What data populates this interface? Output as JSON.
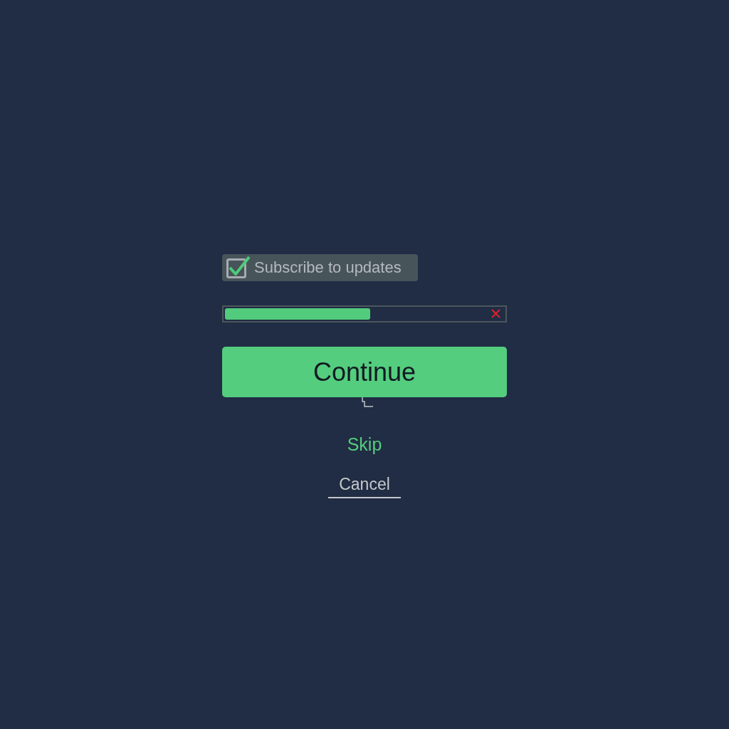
{
  "checkbox": {
    "label": "Subscribe to updates",
    "checked": true
  },
  "progress": {
    "level": 0.52
  },
  "buttons": [
    {
      "kind": "primary",
      "label": "Continue"
    },
    {
      "kind": "link",
      "label": "Skip"
    },
    {
      "kind": "underlined",
      "label": "Cancel"
    }
  ]
}
